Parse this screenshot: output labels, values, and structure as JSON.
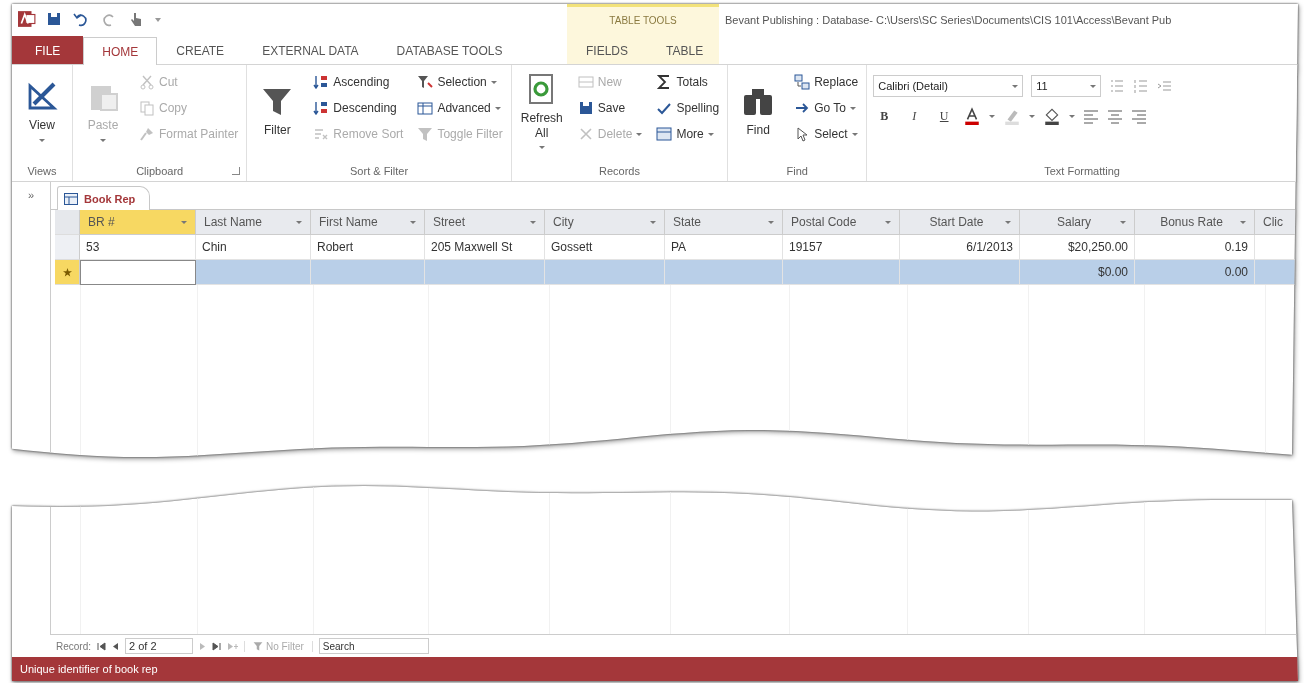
{
  "window": {
    "title": "Bevant Publishing : Database- C:\\Users\\SC Series\\Documents\\CIS 101\\Access\\Bevant Pub"
  },
  "contextual_group": {
    "label": "TABLE TOOLS"
  },
  "tabs": [
    {
      "label": "FILE",
      "kind": "file",
      "selected": false
    },
    {
      "label": "HOME",
      "kind": "tab",
      "selected": true
    },
    {
      "label": "CREATE",
      "kind": "tab",
      "selected": false
    },
    {
      "label": "EXTERNAL DATA",
      "kind": "tab",
      "selected": false
    },
    {
      "label": "DATABASE TOOLS",
      "kind": "tab",
      "selected": false
    },
    {
      "label": "FIELDS",
      "kind": "contextual",
      "selected": false
    },
    {
      "label": "TABLE",
      "kind": "contextual",
      "selected": false
    }
  ],
  "ribbon": {
    "groups": [
      {
        "label": "Views",
        "commands": [
          {
            "label": "View",
            "kind": "large",
            "disabled": false,
            "dropdown": true
          }
        ]
      },
      {
        "label": "Clipboard",
        "launcher": true,
        "commands": [
          {
            "label": "Paste",
            "kind": "large",
            "disabled": true,
            "dropdown": true
          },
          {
            "label": "Cut",
            "kind": "small",
            "disabled": true,
            "dropdown": false
          },
          {
            "label": "Copy",
            "kind": "small",
            "disabled": true,
            "dropdown": false
          },
          {
            "label": "Format Painter",
            "kind": "small",
            "disabled": true,
            "dropdown": false
          }
        ]
      },
      {
        "label": "Sort & Filter",
        "commands": [
          {
            "label": "Filter",
            "kind": "large",
            "disabled": false,
            "dropdown": false
          },
          {
            "label": "Ascending",
            "kind": "small",
            "disabled": false,
            "dropdown": false
          },
          {
            "label": "Descending",
            "kind": "small",
            "disabled": false,
            "dropdown": false
          },
          {
            "label": "Remove Sort",
            "kind": "small",
            "disabled": true,
            "dropdown": false
          },
          {
            "label": "Selection",
            "kind": "small",
            "disabled": false,
            "dropdown": true
          },
          {
            "label": "Advanced",
            "kind": "small",
            "disabled": false,
            "dropdown": true
          },
          {
            "label": "Toggle Filter",
            "kind": "small",
            "disabled": true,
            "dropdown": false
          }
        ]
      },
      {
        "label": "Records",
        "commands": [
          {
            "label": "Refresh All",
            "kind": "large",
            "disabled": false,
            "dropdown": true
          },
          {
            "label": "New",
            "kind": "small",
            "disabled": true,
            "dropdown": false
          },
          {
            "label": "Save",
            "kind": "small",
            "disabled": false,
            "dropdown": false
          },
          {
            "label": "Delete",
            "kind": "small",
            "disabled": true,
            "dropdown": true
          },
          {
            "label": "Totals",
            "kind": "small",
            "disabled": false,
            "dropdown": false
          },
          {
            "label": "Spelling",
            "kind": "small",
            "disabled": false,
            "dropdown": false
          },
          {
            "label": "More",
            "kind": "small",
            "disabled": false,
            "dropdown": true
          }
        ]
      },
      {
        "label": "Find",
        "commands": [
          {
            "label": "Find",
            "kind": "large",
            "disabled": false,
            "dropdown": false
          },
          {
            "label": "Replace",
            "kind": "small",
            "disabled": false,
            "dropdown": false
          },
          {
            "label": "Go To",
            "kind": "small",
            "disabled": false,
            "dropdown": true
          },
          {
            "label": "Select",
            "kind": "small",
            "disabled": false,
            "dropdown": true
          }
        ]
      },
      {
        "label": "Text Formatting",
        "kind": "text_formatting",
        "font": "Calibri (Detail)",
        "size": "11",
        "format_buttons": [
          "B",
          "I",
          "U"
        ]
      }
    ]
  },
  "nav_pane": {
    "toggle": "»"
  },
  "document_tab": {
    "label": "Book Rep"
  },
  "table": {
    "columns": [
      {
        "label": "BR #",
        "selected": true,
        "dropdown": true
      },
      {
        "label": "Last Name",
        "selected": false,
        "dropdown": true
      },
      {
        "label": "First Name",
        "selected": false,
        "dropdown": true
      },
      {
        "label": "Street",
        "selected": false,
        "dropdown": true
      },
      {
        "label": "City",
        "selected": false,
        "dropdown": true
      },
      {
        "label": "State",
        "selected": false,
        "dropdown": true
      },
      {
        "label": "Postal Code",
        "selected": false,
        "dropdown": true
      },
      {
        "label": "Start Date",
        "selected": false,
        "dropdown": true
      },
      {
        "label": "Salary",
        "selected": false,
        "dropdown": true
      },
      {
        "label": "Bonus Rate",
        "selected": false,
        "dropdown": true
      },
      {
        "label": "Clic",
        "selected": false,
        "dropdown": false
      }
    ],
    "rows": [
      {
        "new": false,
        "selected": false,
        "cells": [
          "53",
          "Chin",
          "Robert",
          "205 Maxwell St",
          "Gossett",
          "PA",
          "19157",
          "6/1/2013",
          "$20,250.00",
          "0.19",
          null
        ]
      },
      {
        "new": true,
        "selected": true,
        "cells": [
          null,
          null,
          null,
          null,
          null,
          null,
          null,
          null,
          "$0.00",
          "0.00",
          null
        ]
      }
    ]
  },
  "record_nav": {
    "label": "Record:",
    "current": "2 of 2",
    "filter": "No Filter",
    "search_placeholder": "Search"
  },
  "status_bar": {
    "text": "Unique identifier of book rep"
  }
}
